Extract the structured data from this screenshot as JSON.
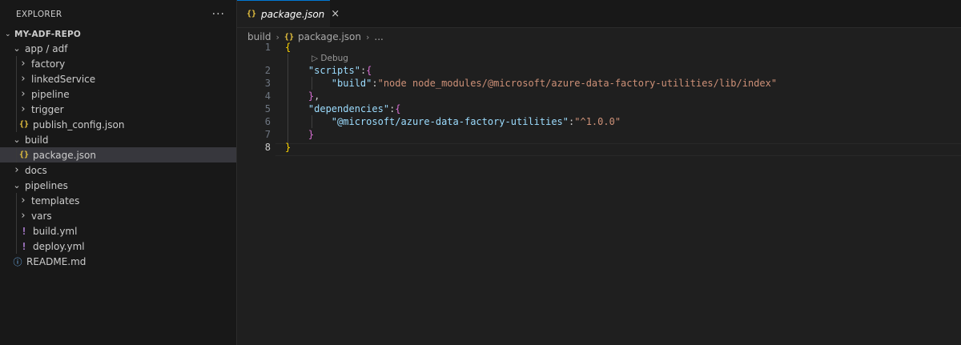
{
  "explorer": {
    "title": "EXPLORER",
    "more_icon": "more-icon",
    "root": "MY-ADF-REPO",
    "tree": [
      {
        "label": "app / adf",
        "type": "folder",
        "open": true,
        "depth": 1
      },
      {
        "label": "factory",
        "type": "folder",
        "open": false,
        "depth": 2
      },
      {
        "label": "linkedService",
        "type": "folder",
        "open": false,
        "depth": 2
      },
      {
        "label": "pipeline",
        "type": "folder",
        "open": false,
        "depth": 2
      },
      {
        "label": "trigger",
        "type": "folder",
        "open": false,
        "depth": 2
      },
      {
        "label": "publish_config.json",
        "type": "json",
        "depth": 2
      },
      {
        "label": "build",
        "type": "folder",
        "open": true,
        "depth": 1
      },
      {
        "label": "package.json",
        "type": "json",
        "depth": 2,
        "selected": true
      },
      {
        "label": "docs",
        "type": "folder",
        "open": false,
        "depth": 1
      },
      {
        "label": "pipelines",
        "type": "folder",
        "open": true,
        "depth": 1
      },
      {
        "label": "templates",
        "type": "folder",
        "open": false,
        "depth": 2
      },
      {
        "label": "vars",
        "type": "folder",
        "open": false,
        "depth": 2
      },
      {
        "label": "build.yml",
        "type": "yml",
        "depth": 2
      },
      {
        "label": "deploy.yml",
        "type": "yml",
        "depth": 2
      },
      {
        "label": "README.md",
        "type": "info",
        "depth": 1
      }
    ]
  },
  "editor": {
    "tab": {
      "label": "package.json",
      "icon": "{}",
      "close": "×"
    },
    "breadcrumb": [
      "build",
      "package.json",
      "..."
    ],
    "breadcrumb_icon": "{}",
    "codelens": "Debug",
    "lines": {
      "n1": "1",
      "n2": "2",
      "n3": "3",
      "n4": "4",
      "n5": "5",
      "n6": "6",
      "n7": "7",
      "n8": "8",
      "scripts_key": "\"scripts\"",
      "build_key": "\"build\"",
      "build_val": "\"node node_modules/@microsoft/azure-data-factory-utilities/lib/index\"",
      "deps_key": "\"dependencies\"",
      "dep_key": "\"@microsoft/azure-data-factory-utilities\"",
      "dep_val": "\"^1.0.0\""
    }
  },
  "colors": {
    "accent": "#0078d4",
    "json_icon": "#e8c33f",
    "yml_icon": "#b180d7",
    "info_icon": "#75beff"
  }
}
